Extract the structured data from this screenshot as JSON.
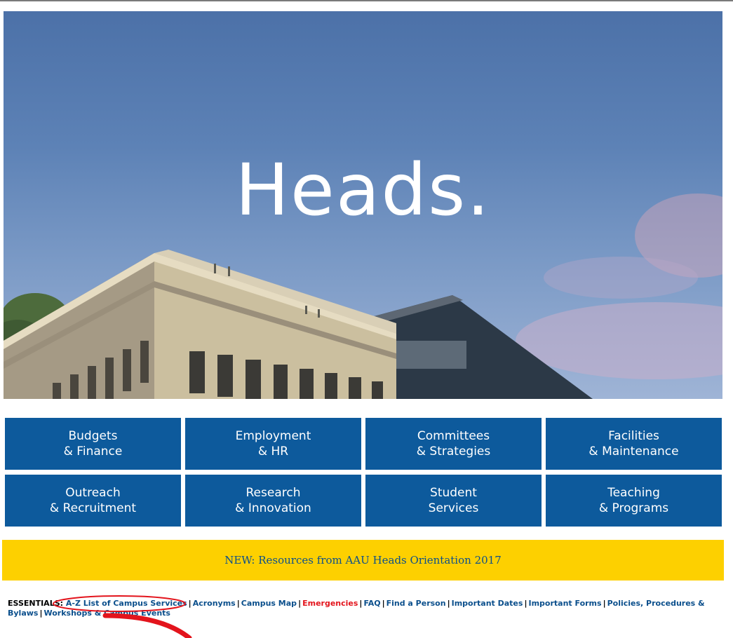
{
  "hero": {
    "title": "Heads."
  },
  "tiles": [
    {
      "line1": "Budgets",
      "line2": "& Finance"
    },
    {
      "line1": "Employment",
      "line2": "& HR"
    },
    {
      "line1": "Committees",
      "line2": "& Strategies"
    },
    {
      "line1": "Facilities",
      "line2": "& Maintenance"
    },
    {
      "line1": "Outreach",
      "line2": "& Recruitment"
    },
    {
      "line1": "Research",
      "line2": "& Innovation"
    },
    {
      "line1": "Student",
      "line2": "Services"
    },
    {
      "line1": "Teaching",
      "line2": "& Programs"
    }
  ],
  "banner": {
    "text": "NEW: Resources from AAU Heads Orientation 2017"
  },
  "essentials": {
    "label": "ESSENTIALS:",
    "links": [
      "A-Z List of Campus Services",
      "Acronyms",
      "Campus Map",
      "Emergencies",
      "FAQ",
      "Find a Person",
      "Important Dates",
      "Important Forms",
      "Policies, Procedures & Bylaws",
      "Workshops & Campus Events"
    ],
    "separator": "|"
  },
  "colors": {
    "tile_bg": "#0d5a9c",
    "banner_bg": "#fdd000",
    "link": "#0b4f8c",
    "emergency": "#e3141c",
    "annotation": "#e3141c"
  }
}
